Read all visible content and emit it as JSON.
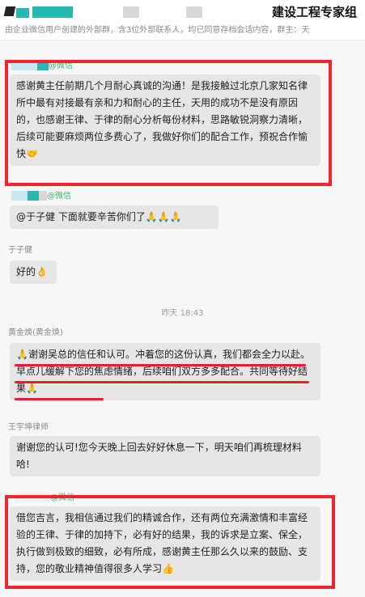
{
  "header": {
    "title": "建设工程专家组",
    "subtitle": "由企业微信用户创建的外部群，含3位外部联系人，均已同意存档会话内容，群主：天"
  },
  "messages": [
    {
      "sender": "@微信",
      "text": "感谢黄主任前期几个月耐心真诚的沟通！是我接触过北京几家知名律所中最有对接最有亲和力和耐心的主任，天用的成功不是没有原因的，也感谢王律、于律的耐心分析每份材料，思路敏锐洞察力清晰，后续可能要麻烦两位多费心了，我做好你们的配合工作，预祝合作愉快",
      "emoji": "🤝"
    },
    {
      "sender": "@微信",
      "text": "@于子健 下面就要辛苦你们了",
      "emoji": "🙏🙏🙏"
    },
    {
      "sender": "于子健",
      "text": "好的",
      "emoji": "👌"
    },
    {
      "timestamp": "昨天 18:43"
    },
    {
      "sender": "黄金焕(黄金焕)",
      "text": "谢谢吴总的信任和认可。冲着您的这份认真，我们都会全力以赴。早点儿缓解下您的焦虑情绪，后续咱们双方多多配合。共同等待好结果",
      "emoji_pre": "🙏",
      "emoji": "🙏"
    },
    {
      "sender": "王宇坤律师",
      "text": "谢谢您的认可!您今天晚上回去好好休息一下，明天咱们再梳理材料哈!"
    },
    {
      "sender": "@微信",
      "text": "借您吉言，我相信通过我们的精诚合作，还有两位充满激情和丰富经验的王律、于律的加持下，必有好的结果，我的诉求是立案、保全，执行做到极致的细致，必有所成，感谢黄主任那么久以来的鼓励、支持，您的敬业精神值得很多人学习",
      "emoji": "👍"
    }
  ],
  "colors": {
    "highlight_box": "#f0262f",
    "underline": "#e81e2b",
    "wechat_tag": "#3cb371"
  }
}
